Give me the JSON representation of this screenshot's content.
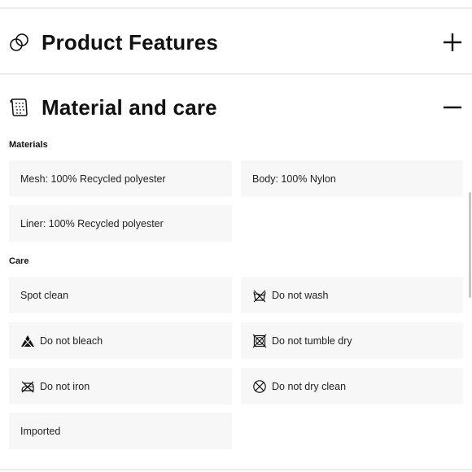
{
  "sections": {
    "features": {
      "title": "Product Features",
      "icon": "overlapping-circles-icon",
      "toggle": "plus-icon"
    },
    "material": {
      "title": "Material and care",
      "icon": "fabric-swatch-icon",
      "toggle": "minus-icon"
    }
  },
  "materials": {
    "label": "Materials",
    "items": [
      "Mesh: 100% Recycled polyester",
      "Body: 100% Nylon",
      "Liner: 100% Recycled polyester"
    ]
  },
  "care": {
    "label": "Care",
    "items": [
      {
        "text": "Spot clean",
        "icon": ""
      },
      {
        "text": "Do not wash",
        "icon": "do-not-wash-icon"
      },
      {
        "text": "Do not bleach",
        "icon": "do-not-bleach-icon"
      },
      {
        "text": "Do not tumble dry",
        "icon": "do-not-tumble-dry-icon"
      },
      {
        "text": "Do not iron",
        "icon": "do-not-iron-icon"
      },
      {
        "text": "Do not dry clean",
        "icon": "do-not-dry-clean-icon"
      },
      {
        "text": "Imported",
        "icon": ""
      }
    ]
  }
}
